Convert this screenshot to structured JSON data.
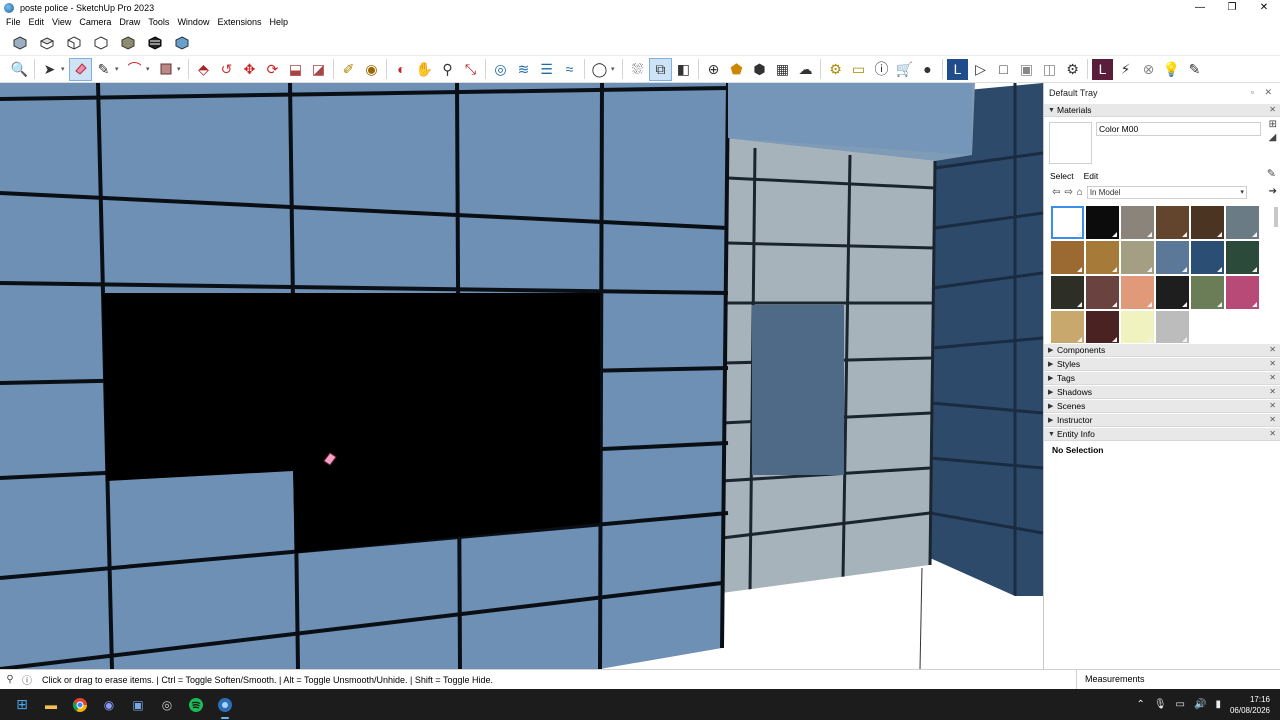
{
  "window": {
    "title": "poste police - SketchUp Pro 2023",
    "controls": [
      "—",
      "❐",
      "✕"
    ]
  },
  "menu": [
    "File",
    "Edit",
    "View",
    "Camera",
    "Draw",
    "Tools",
    "Window",
    "Extensions",
    "Help"
  ],
  "toolbar1": {
    "icons": [
      "iso-view-icon",
      "top-view-icon",
      "front-view-icon",
      "right-view-icon",
      "back-view-icon",
      "left-view-icon",
      "bottom-view-icon"
    ]
  },
  "toolbar2": {
    "active_tool": "eraser-icon"
  },
  "tray": {
    "title": "Default Tray",
    "materials": {
      "header": "Materials",
      "current_name": "Color M00",
      "tabs": [
        "Select",
        "Edit"
      ],
      "library": "In Model",
      "swatches": [
        "#ffffff",
        "#0c0c0c",
        "#8a847b",
        "#62452c",
        "#4b3422",
        "#6b7b86",
        "#9a6a32",
        "#a67b3a",
        "#a49f82",
        "#5b7898",
        "#2b4e75",
        "#2c4a3a",
        "#2d2f26",
        "#6a4240",
        "#e09a7a",
        "#1e1e1e",
        "#6a7d56",
        "#b84a78",
        "#c9a86e",
        "#4a2222",
        "#f0f3c0",
        "#bcbcbc"
      ]
    },
    "panels": [
      "Components",
      "Styles",
      "Tags",
      "Shadows",
      "Scenes",
      "Instructor"
    ],
    "entity_info": {
      "header": "Entity Info",
      "value": "No Selection"
    }
  },
  "status": {
    "message": "Click or drag to erase items. | Ctrl = Toggle Soften/Smooth. | Alt = Toggle Unsmooth/Unhide. | Shift = Toggle Hide.",
    "measurements_label": "Measurements"
  },
  "taskbar": {
    "apps": [
      "start-icon",
      "file-explorer-icon",
      "chrome-icon",
      "discord-icon",
      "app-icon",
      "git-icon",
      "spotify-icon",
      "sketchup-icon"
    ],
    "time": "17:16",
    "date": "06/08/2026"
  }
}
